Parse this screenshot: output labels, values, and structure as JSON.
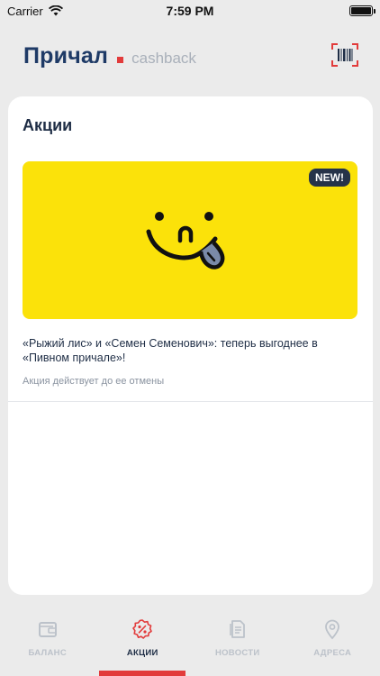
{
  "status_bar": {
    "carrier": "Carrier",
    "time": "7:59 PM"
  },
  "header": {
    "brand_name": "Причал",
    "brand_sub": "cashback",
    "barcode_icon": "barcode-scan-icon"
  },
  "card": {
    "title": "Акции",
    "promo": {
      "badge": "NEW!",
      "text": "«Рыжий лис» и «Семен Семенович»: теперь выгоднее в «Пивном причале»!",
      "valid": "Акция действует до ее отмены",
      "banner_color": "#fbe20a"
    }
  },
  "tabs": [
    {
      "label": "БАЛАНС",
      "icon": "wallet-icon",
      "active": false
    },
    {
      "label": "АКЦИИ",
      "icon": "percent-badge-icon",
      "active": true
    },
    {
      "label": "НОВОСТИ",
      "icon": "news-icon",
      "active": false
    },
    {
      "label": "АДРЕСА",
      "icon": "location-pin-icon",
      "active": false
    }
  ],
  "colors": {
    "brand": "#1e3a66",
    "accent": "#e23b3b",
    "inactive": "#bcc2ca"
  }
}
